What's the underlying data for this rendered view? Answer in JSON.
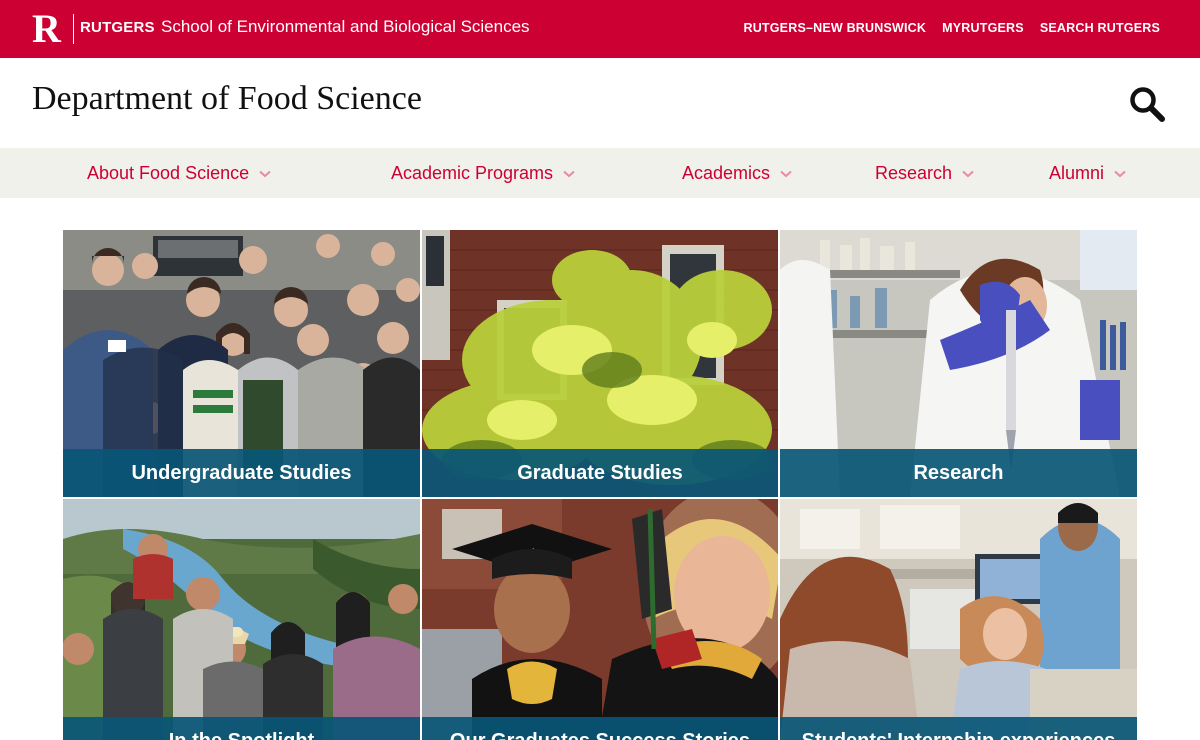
{
  "brand": {
    "logo_letter": "R",
    "logo_word": "RUTGERS",
    "school": "School of Environmental and Biological Sciences",
    "color": "#cc0033"
  },
  "utility_nav": [
    "RUTGERS–NEW BRUNSWICK",
    "MYRUTGERS",
    "SEARCH RUTGERS"
  ],
  "header": {
    "title": "Department of Food Science",
    "search_icon": "search-icon"
  },
  "main_nav": [
    {
      "label": "About Food Science"
    },
    {
      "label": "Academic Programs"
    },
    {
      "label": "Academics"
    },
    {
      "label": "Research"
    },
    {
      "label": "Alumni"
    }
  ],
  "tiles": [
    {
      "caption": "Undergraduate Studies"
    },
    {
      "caption": "Graduate Studies"
    },
    {
      "caption": "Research"
    },
    {
      "caption": "In the Spotlight"
    },
    {
      "caption": "Our Graduates Success Stories"
    },
    {
      "caption": "Students' Internship experiences"
    }
  ],
  "colors": {
    "caption_bg": "#095676",
    "nav_bg": "#f1f1ec"
  }
}
